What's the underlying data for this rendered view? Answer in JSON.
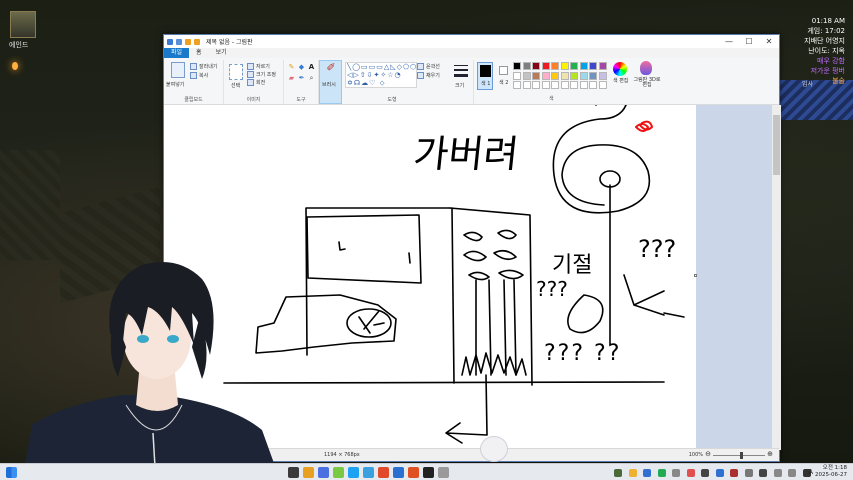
{
  "game": {
    "character_name": "에인드",
    "hud": {
      "clock": "01:18 AM",
      "game_time": "게임: 17:02",
      "game_mode": "지배단 어영지",
      "difficulty": "난이도: 지옥",
      "line5": "매우 강함",
      "line6": "저가운 펑버",
      "line7": "불술"
    },
    "side_text": "입사"
  },
  "paint": {
    "title": "제목 없음 - 그림판",
    "window_controls": {
      "minimize": "—",
      "maximize": "☐",
      "close": "✕"
    },
    "tabs": [
      {
        "label": "파일"
      },
      {
        "label": "홈"
      },
      {
        "label": "보기"
      }
    ],
    "ribbon": {
      "clipboard": {
        "paste": "붙여넣기",
        "cut": "잘라내기",
        "copy": "복사",
        "label": "클립보드"
      },
      "image": {
        "select": "선택",
        "crop": "자르기",
        "resize": "크기 조정",
        "rotate": "회전",
        "label": "이미지"
      },
      "tools": {
        "label": "도구",
        "text_tool": "A"
      },
      "brushes": {
        "label": "브러시"
      },
      "shapes": {
        "glyphs": "╲◯▭▭▭△◺◇⬠⬡\n◁▷⇧⇩✦✧☆◔\n✡☊☁♡ ⬦",
        "outline": "윤곽선",
        "fill": "채우기",
        "label": "도형"
      },
      "size": {
        "label": "크기"
      },
      "colors": {
        "color1": "색 1",
        "color2": "색 2",
        "edit_colors": "색 편집",
        "paint3d": "그림판 3D로 편집",
        "label": "색",
        "swatches": [
          "#000000",
          "#7f7f7f",
          "#880015",
          "#ed1c24",
          "#ff7f27",
          "#fff200",
          "#22b14c",
          "#00a2e8",
          "#3f48cc",
          "#a349a4",
          "#ffffff",
          "#c3c3c3",
          "#b97a57",
          "#ffaec9",
          "#ffc90e",
          "#efe4b0",
          "#b5e61d",
          "#99d9ea",
          "#7092be",
          "#c8bfe7",
          "#ffffff",
          "#ffffff",
          "#ffffff",
          "#ffffff",
          "#ffffff",
          "#ffffff",
          "#ffffff",
          "#ffffff",
          "#ffffff",
          "#ffffff"
        ]
      }
    },
    "canvas": {
      "drawing": {
        "title_scribble": "가버려",
        "question_marks_1": "???",
        "question_marks_2": "???",
        "question_marks_3": "??? ??",
        "side_scribble": "기절"
      }
    },
    "status": {
      "canvas_size": "1194 × 768px",
      "zoom": "100%",
      "zoom_minus": "⊖",
      "zoom_plus": "⊕"
    }
  },
  "taskbar": {
    "icon_colors": [
      "#3a3a3a",
      "#e8a020",
      "#4a6fe0",
      "#7ac943",
      "#1da1f2",
      "#3aa0e0",
      "#e04a2a",
      "#2a70d0",
      "#e05020",
      "#222222",
      "#9a9a9a"
    ],
    "tray_colors": [
      "#4a6a3a",
      "#f0b030",
      "#3070d0",
      "#22aa55",
      "#888888",
      "#e05050",
      "#444444",
      "#3070d0",
      "#aa3030",
      "#777777",
      "#444444",
      "#888888",
      "#888888",
      "#333333"
    ],
    "language": "A",
    "time": "오전 1:18",
    "date": "2025-06-27"
  }
}
